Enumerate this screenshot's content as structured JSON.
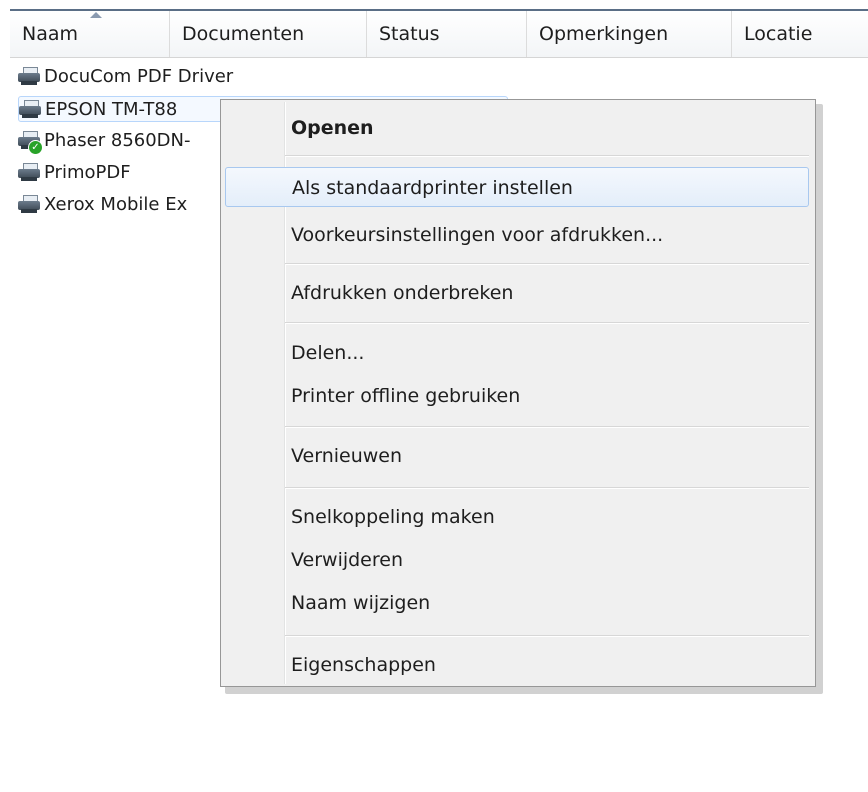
{
  "columns": [
    "Naam",
    "Documenten",
    "Status",
    "Opmerkingen",
    "Locatie"
  ],
  "printers": [
    {
      "name": "DocuCom PDF Driver",
      "default": false
    },
    {
      "name": "EPSON TM-T88",
      "default": false
    },
    {
      "name": "Phaser 8560DN-",
      "default": true
    },
    {
      "name": "PrimoPDF",
      "default": false
    },
    {
      "name": "Xerox Mobile Ex",
      "default": false
    }
  ],
  "menu": {
    "open": "Openen",
    "set_default": "Als standaardprinter instellen",
    "preferences": "Voorkeursinstellingen voor afdrukken...",
    "pause": "Afdrukken onderbreken",
    "share": "Delen...",
    "use_offline": "Printer offline gebruiken",
    "refresh": "Vernieuwen",
    "create_shortcut": "Snelkoppeling maken",
    "delete": "Verwijderen",
    "rename": "Naam wijzigen",
    "properties": "Eigenschappen"
  },
  "icons": {
    "printer": "printer-icon",
    "default_badge": "default-check-icon",
    "sort": "sort-ascending-icon"
  },
  "colors": {
    "selection_border": "#b8d6fb",
    "menu_hover_border": "#a8c8ef",
    "default_badge": "#29a329"
  }
}
